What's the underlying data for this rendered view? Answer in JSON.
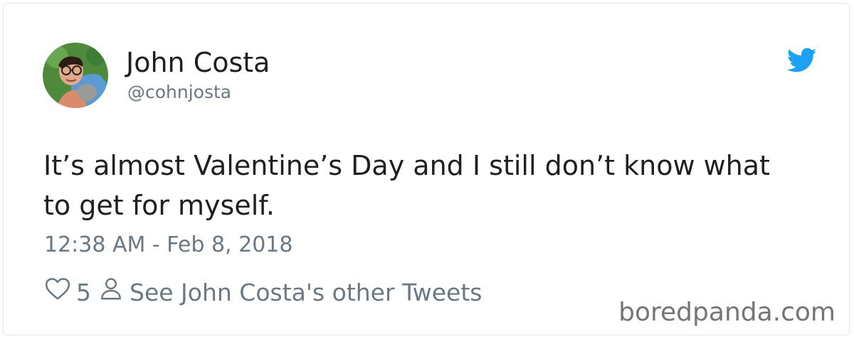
{
  "tweet": {
    "author": {
      "name": "John Costa",
      "handle": "@cohnjosta",
      "avatar_icon": "profile-photo"
    },
    "brand_icon": "twitter-bird-icon",
    "brand_color": "#1da1f2",
    "text": "It’s almost Valentine’s Day and I still don’t know what to get for myself.",
    "timestamp": "12:38 AM - Feb 8, 2018",
    "like_count": "5",
    "other_tweets_link": "See John Costa's other Tweets"
  },
  "watermark": "boredpanda.com"
}
